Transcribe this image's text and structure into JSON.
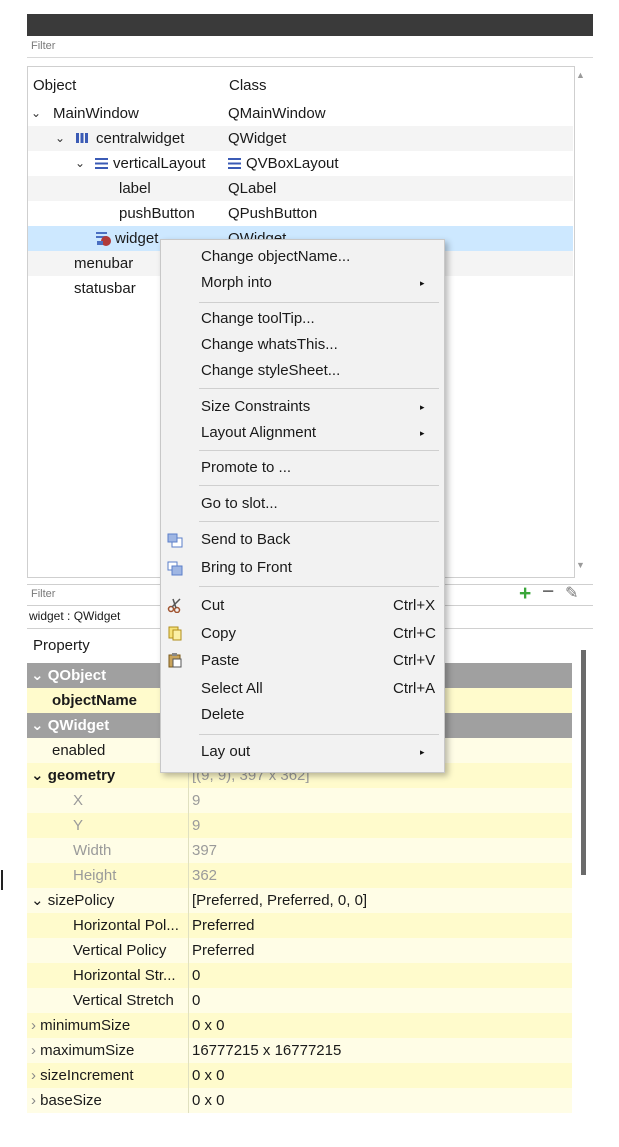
{
  "object_inspector": {
    "filter_placeholder": "Filter",
    "headers": {
      "object": "Object",
      "class": "Class"
    },
    "rows": [
      {
        "name": "MainWindow",
        "class": "QMainWindow"
      },
      {
        "name": "centralwidget",
        "class": "QWidget"
      },
      {
        "name": "verticalLayout",
        "class": "QVBoxLayout"
      },
      {
        "name": "label",
        "class": "QLabel"
      },
      {
        "name": "pushButton",
        "class": "QPushButton"
      },
      {
        "name": "widget",
        "class": "QWidget"
      },
      {
        "name": "menubar",
        "class": ""
      },
      {
        "name": "statusbar",
        "class": ""
      }
    ]
  },
  "context_menu": {
    "items": [
      {
        "label": "Change objectName...",
        "shortcut": ""
      },
      {
        "label": "Morph into",
        "shortcut": ""
      },
      {
        "label": "Change toolTip...",
        "shortcut": ""
      },
      {
        "label": "Change whatsThis...",
        "shortcut": ""
      },
      {
        "label": "Change styleSheet...",
        "shortcut": ""
      },
      {
        "label": "Size Constraints",
        "shortcut": ""
      },
      {
        "label": "Layout Alignment",
        "shortcut": ""
      },
      {
        "label": "Promote to ...",
        "shortcut": ""
      },
      {
        "label": "Go to slot...",
        "shortcut": ""
      },
      {
        "label": "Send to Back",
        "shortcut": ""
      },
      {
        "label": "Bring to Front",
        "shortcut": ""
      },
      {
        "label": "Cut",
        "shortcut": "Ctrl+X"
      },
      {
        "label": "Copy",
        "shortcut": "Ctrl+C"
      },
      {
        "label": "Paste",
        "shortcut": "Ctrl+V"
      },
      {
        "label": "Select All",
        "shortcut": "Ctrl+A"
      },
      {
        "label": "Delete",
        "shortcut": ""
      },
      {
        "label": "Lay out",
        "shortcut": ""
      }
    ],
    "submenu_arrow": "▸"
  },
  "property_editor": {
    "filter_placeholder": "Filter",
    "object_label": "widget : QWidget",
    "header_property": "Property",
    "rows": [
      {
        "name": "QObject",
        "value": ""
      },
      {
        "name": "objectName",
        "value": ""
      },
      {
        "name": "QWidget",
        "value": ""
      },
      {
        "name": "enabled",
        "value": ""
      },
      {
        "name": "geometry",
        "value": "[(9, 9), 397 x 362]"
      },
      {
        "name": "X",
        "value": "9"
      },
      {
        "name": "Y",
        "value": "9"
      },
      {
        "name": "Width",
        "value": "397"
      },
      {
        "name": "Height",
        "value": "362"
      },
      {
        "name": "sizePolicy",
        "value": "[Preferred, Preferred, 0, 0]"
      },
      {
        "name": "Horizontal Pol...",
        "value": "Preferred"
      },
      {
        "name": "Vertical Policy",
        "value": "Preferred"
      },
      {
        "name": "Horizontal Str...",
        "value": "0"
      },
      {
        "name": "Vertical Stretch",
        "value": "0"
      },
      {
        "name": "minimumSize",
        "value": "0 x 0"
      },
      {
        "name": "maximumSize",
        "value": "16777215 x 16777215"
      },
      {
        "name": "sizeIncrement",
        "value": "0 x 0"
      },
      {
        "name": "baseSize",
        "value": "0 x 0"
      }
    ]
  },
  "colors": {
    "selection": "#cde8ff",
    "group_header": "#a0a0a0",
    "changed_property": "#fffbcc",
    "add_button": "#3aa63a"
  }
}
